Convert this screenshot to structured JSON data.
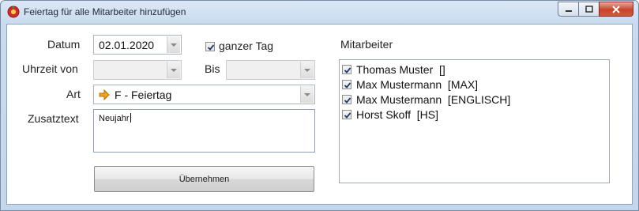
{
  "window": {
    "title": "Feiertag für alle Mitarbeiter hinzufügen"
  },
  "form": {
    "datum_label": "Datum",
    "datum_value": "02.01.2020",
    "ganzer_tag_label": "ganzer Tag",
    "ganzer_tag_checked": true,
    "uhrzeit_von_label": "Uhrzeit von",
    "uhrzeit_von_value": "",
    "bis_label": "Bis",
    "bis_value": "",
    "art_label": "Art",
    "art_value": "F - Feiertag",
    "zusatztext_label": "Zusatztext",
    "zusatztext_value": "Neujahr",
    "apply_button_label": "Übernehmen"
  },
  "employees": {
    "header": "Mitarbeiter",
    "items": [
      {
        "label": "Thomas Muster  []",
        "checked": true
      },
      {
        "label": "Max Mustermann  [MAX]",
        "checked": true
      },
      {
        "label": "Max Mustermann  [ENGLISCH]",
        "checked": true
      },
      {
        "label": "Horst Skoff  [HS]",
        "checked": true
      }
    ]
  },
  "colors": {
    "titlebar": "#c9dbf0",
    "close_button": "#c7432b",
    "art_arrow": "#f2a21b"
  },
  "icons": {
    "app": "red-circle-app-icon",
    "art": "arrow-right-icon"
  }
}
